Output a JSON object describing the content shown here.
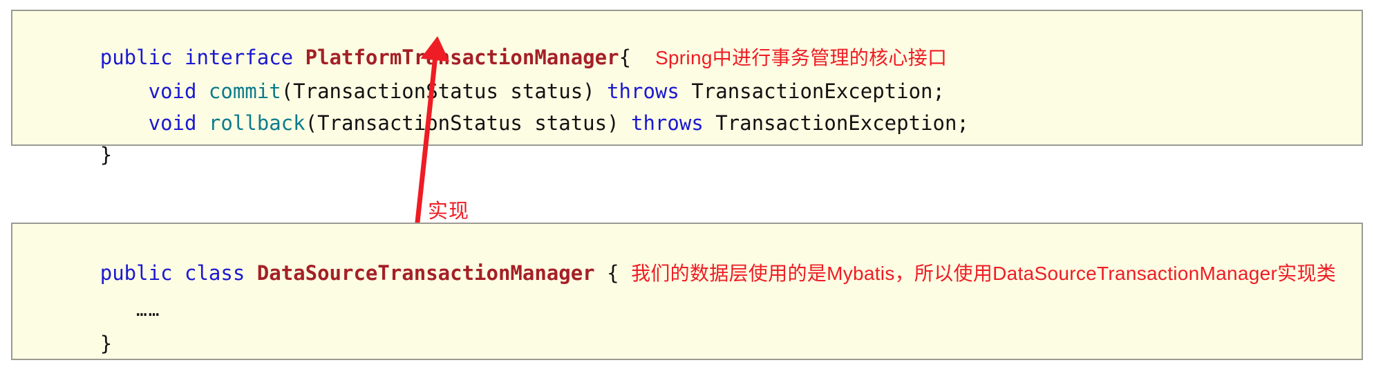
{
  "blocks": [
    {
      "id": "interface-block",
      "lines": [
        {
          "kw1": "public",
          "kw2": "interface",
          "type_name": "PlatformTransactionManager",
          "brace": "{",
          "annotation": "Spring中进行事务管理的核心接口"
        },
        {
          "kw": "void",
          "method": "commit",
          "params": "(TransactionStatus status) ",
          "throws_kw": "throws",
          "exception": " TransactionException;"
        },
        {
          "kw": "void",
          "method": "rollback",
          "params": "(TransactionStatus status) ",
          "throws_kw": "throws",
          "exception": " TransactionException;"
        },
        {
          "close_brace": "}"
        }
      ]
    },
    {
      "id": "class-block",
      "lines": [
        {
          "kw1": "public",
          "kw2": "class",
          "type_name": "DataSourceTransactionManager",
          "brace": "{",
          "annotation": "我们的数据层使用的是Mybatis，所以使用DataSourceTransactionManager实现类"
        },
        {
          "ellipsis": "……"
        },
        {
          "close_brace": "}"
        }
      ]
    }
  ],
  "annotations": {
    "implements_label": "实现",
    "arrow_color": "#ee1c24"
  },
  "colors": {
    "code_background": "#fdfde4",
    "code_border": "#9a9a92",
    "keyword": "#1a18d0",
    "type_name": "#a42026",
    "method_name": "#0d7b8c",
    "plain_text": "#111111",
    "annotation_red": "#ee1c24"
  }
}
